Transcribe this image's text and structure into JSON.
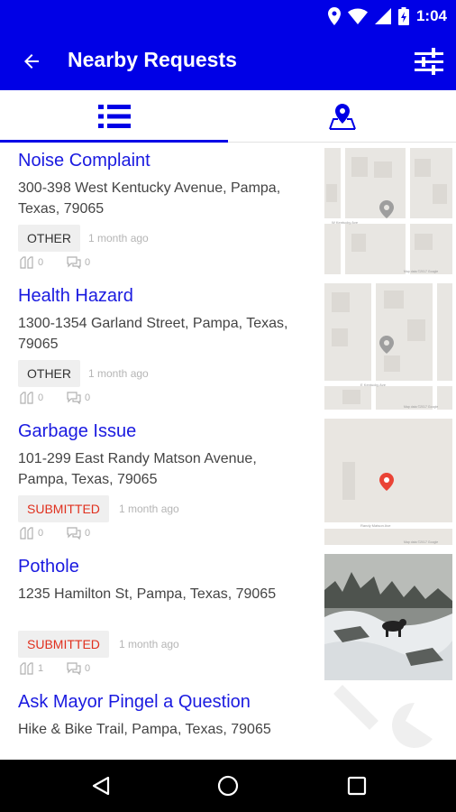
{
  "status_bar": {
    "time": "1:04",
    "icons": [
      "location-icon",
      "wifi-icon",
      "signal-icon",
      "battery-charging-icon"
    ]
  },
  "app_bar": {
    "title": "Nearby Requests",
    "back_icon": "arrow-left-icon",
    "filter_icon": "sliders-icon"
  },
  "tabs": [
    {
      "name": "list",
      "icon": "list-icon",
      "selected": true
    },
    {
      "name": "map",
      "icon": "map-marker-icon",
      "selected": false
    }
  ],
  "accent_color": "#0000e6",
  "requests": [
    {
      "title": "Noise Complaint",
      "address": "300-398  West Kentucky Avenue, Pampa, Texas, 79065",
      "status": "OTHER",
      "time": "1 month ago",
      "votes": "0",
      "comments": "0",
      "thumbnail": "map",
      "map_labels": [
        "W Kentucky Ave",
        "Map data ©2017 Google"
      ]
    },
    {
      "title": "Health Hazard",
      "address": "1300-1354  Garland Street, Pampa, Texas, 79065",
      "status": "OTHER",
      "time": "1 month ago",
      "votes": "0",
      "comments": "0",
      "thumbnail": "map",
      "map_labels": [
        "E Kentucky Ave",
        "Map data ©2017 Google"
      ]
    },
    {
      "title": "Garbage Issue",
      "address": "101-299  East Randy Matson Avenue, Pampa, Texas, 79065",
      "status": "SUBMITTED",
      "time": "1 month ago",
      "votes": "0",
      "comments": "0",
      "thumbnail": "map",
      "map_labels": [
        "Randy Matson Ave",
        "Map data ©2017 Google"
      ]
    },
    {
      "title": "Pothole",
      "address": "1235  Hamilton St, Pampa, Texas, 79065",
      "status": "SUBMITTED",
      "time": "1 month ago",
      "votes": "1",
      "comments": "0",
      "thumbnail": "photo"
    },
    {
      "title": "Ask Mayor Pingel a Question",
      "address": "Hike & Bike Trail, Pampa, Texas, 79065"
    }
  ],
  "nav_bar": {
    "icons": [
      "back-triangle-icon",
      "home-circle-icon",
      "recents-square-icon"
    ]
  }
}
